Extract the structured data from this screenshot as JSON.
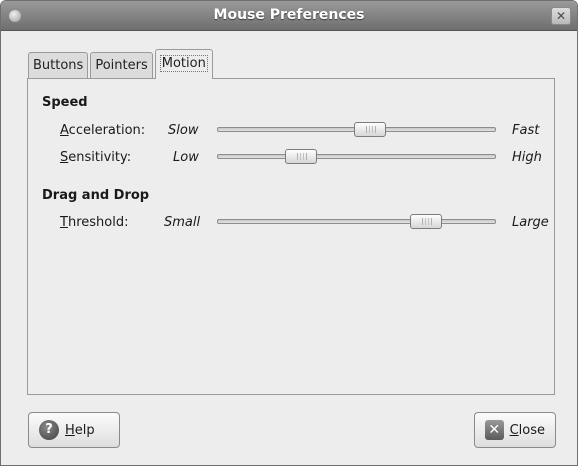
{
  "window": {
    "title": "Mouse Preferences",
    "close_glyph": "✕"
  },
  "tabs": [
    {
      "label": "Buttons"
    },
    {
      "label": "Pointers"
    },
    {
      "label": "Motion"
    }
  ],
  "speed": {
    "heading": "Speed",
    "acceleration": {
      "label_key": "A",
      "label_rest": "cceleration:",
      "min_label": "Slow",
      "max_label": "Fast",
      "value_fraction": 0.55
    },
    "sensitivity": {
      "label_key": "S",
      "label_rest": "ensitivity:",
      "min_label": "Low",
      "max_label": "High",
      "value_fraction": 0.3
    }
  },
  "drag_drop": {
    "heading": "Drag and Drop",
    "threshold": {
      "label_key": "T",
      "label_rest": "hreshold:",
      "min_label": "Small",
      "max_label": "Large",
      "value_fraction": 0.75
    }
  },
  "footer": {
    "help_key": "H",
    "help_rest": "elp",
    "close_key": "C",
    "close_rest": "lose"
  },
  "icons": {
    "help": "help-icon",
    "close": "close-icon"
  }
}
